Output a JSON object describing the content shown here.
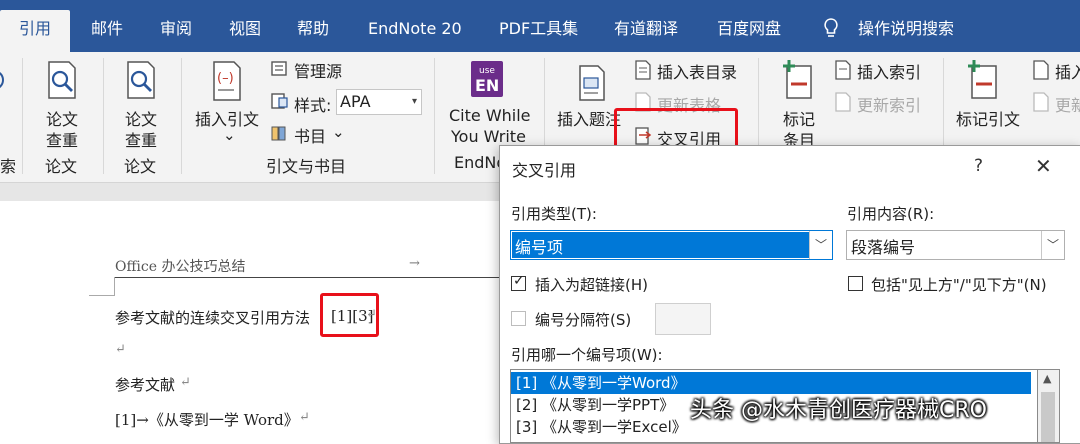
{
  "tabs": [
    {
      "label": "引用",
      "active": true
    },
    {
      "label": "邮件"
    },
    {
      "label": "审阅"
    },
    {
      "label": "视图"
    },
    {
      "label": "帮助"
    },
    {
      "label": "EndNote 20"
    },
    {
      "label": "PDF工具集"
    },
    {
      "label": "有道翻译"
    },
    {
      "label": "百度网盘"
    },
    {
      "label": "操作说明搜索"
    }
  ],
  "ribbon": {
    "g_lunwen1": {
      "line1": "论文",
      "line2": "查重",
      "group": "论文"
    },
    "g_lunwen2": {
      "line1": "论文",
      "line2": "查重",
      "group": "论文"
    },
    "left_group_partial": "索",
    "citations": {
      "insert_citation": "插入引文",
      "insert_citation_arrow": "⌄",
      "manage_sources": "管理源",
      "style_label": "样式:",
      "style_value": "APA",
      "bibliography": "书目",
      "bibliography_arrow": "⌄",
      "group": "引文与书目"
    },
    "endnote": {
      "icon_top": "use",
      "icon_main": "EN",
      "line1": "Cite While",
      "line2": "You Write",
      "group": "EndNo"
    },
    "captions": {
      "insert_caption": "插入题注",
      "insert_table_of_figures": "插入表目录",
      "update_table": "更新表格",
      "cross_reference": "交叉引用"
    },
    "index": {
      "mark_entry_1": "标记",
      "mark_entry_2": "条目",
      "insert_index": "插入索引",
      "update_index": "更新索引"
    },
    "toa": {
      "mark_citation": "标记引文",
      "insert_partial": "插入",
      "update_partial": "更新"
    }
  },
  "document": {
    "header_text": "Office 办公技巧总结",
    "header_arrow": "→",
    "para1_text": "参考文献的连续交叉引用方法",
    "para1_refs": "[1][3]",
    "para_mark": "↵",
    "blank_mark": "↵",
    "heading": "参考文献",
    "heading_mark": "↵",
    "ref1_text": "[1]→《从零到一学 Word》",
    "ref1_mark": "↵"
  },
  "dialog": {
    "title": "交叉引用",
    "help": "?",
    "close": "✕",
    "ref_type_label": "引用类型(T):",
    "ref_type_value": "编号项",
    "ref_content_label": "引用内容(R):",
    "ref_content_value": "段落编号",
    "insert_hyperlink_label": "插入为超链接(H)",
    "insert_hyperlink_checked": true,
    "include_above_below_label": "包括\"见上方\"/\"见下方\"(N)",
    "include_above_below_checked": false,
    "separate_numbers_label": "编号分隔符(S)",
    "which_item_label": "引用哪一个编号项(W):",
    "items": [
      "[1] 《从零到一学Word》",
      "[2] 《从零到一学PPT》",
      "[3] 《从零到一学Excel》"
    ],
    "selected_index": 0
  },
  "watermark": "头条 @水木青创医疗器械CRO",
  "colors": {
    "ribbon_tab_bar": "#2b579a",
    "highlight_red": "#e8101a",
    "selection_blue": "#0078d7"
  }
}
